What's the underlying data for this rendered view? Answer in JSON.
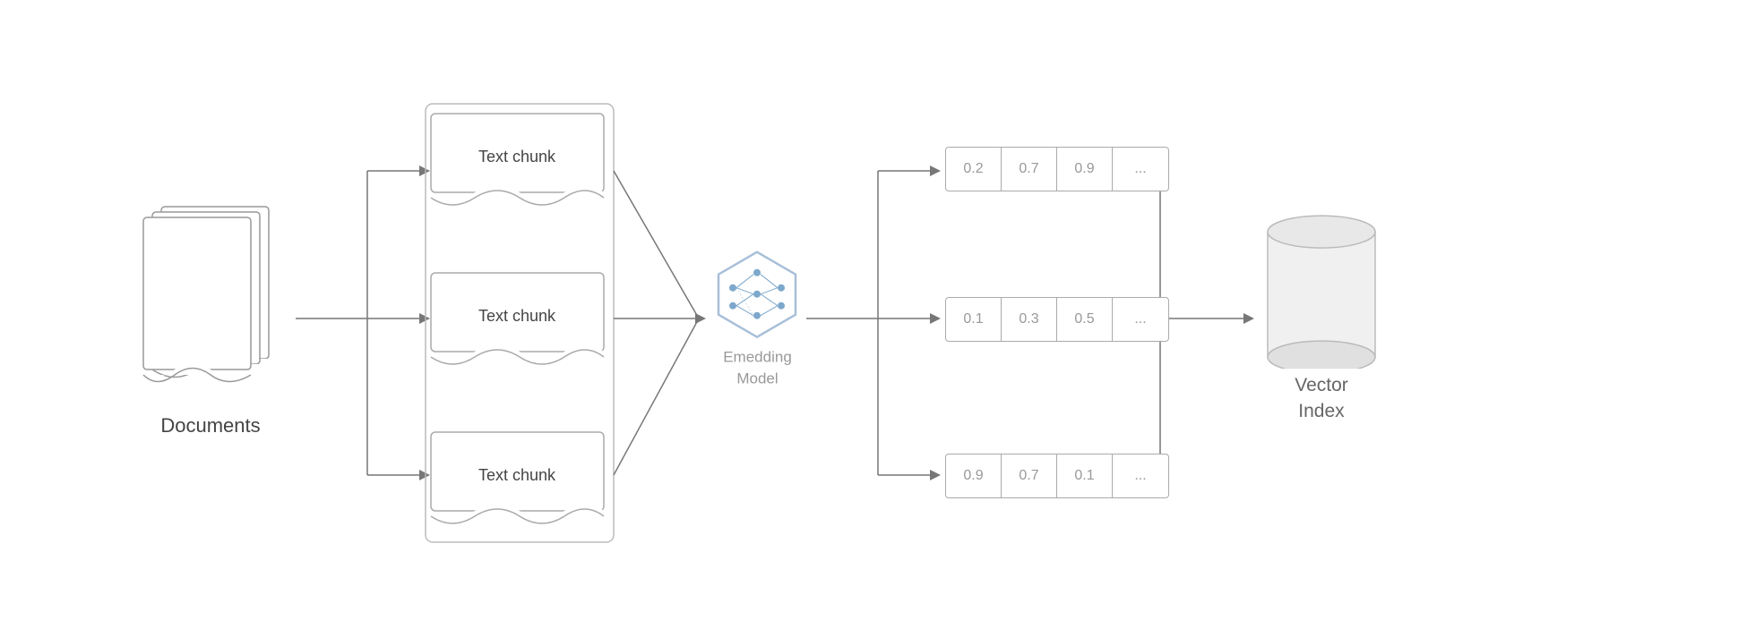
{
  "diagram": {
    "documents_label": "Documents",
    "chunks": [
      {
        "label": "Text chunk"
      },
      {
        "label": "Text chunk"
      },
      {
        "label": "Text chunk"
      }
    ],
    "embedding_label_line1": "Emedding",
    "embedding_label_line2": "Model",
    "vectors": [
      {
        "cells": [
          "0.2",
          "0.7",
          "0.9",
          "..."
        ]
      },
      {
        "cells": [
          "0.1",
          "0.3",
          "0.5",
          "..."
        ]
      },
      {
        "cells": [
          "0.9",
          "0.7",
          "0.1",
          "..."
        ]
      }
    ],
    "vector_index_label_line1": "Vector",
    "vector_index_label_line2": "Index"
  }
}
